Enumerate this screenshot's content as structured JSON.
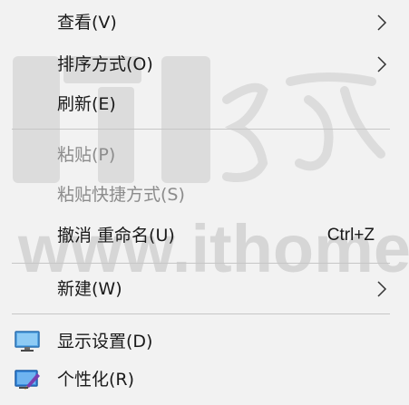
{
  "menu": {
    "items": [
      {
        "label": "查看(V)",
        "disabled": false,
        "submenu": true
      },
      {
        "label": "排序方式(O)",
        "disabled": false,
        "submenu": true
      },
      {
        "label": "刷新(E)",
        "disabled": false
      },
      {
        "label": "粘贴(P)",
        "disabled": true
      },
      {
        "label": "粘贴快捷方式(S)",
        "disabled": true
      },
      {
        "label": "撤消 重命名(U)",
        "shortcut": "Ctrl+Z",
        "disabled": false
      },
      {
        "label": "新建(W)",
        "disabled": false,
        "submenu": true
      },
      {
        "label": "显示设置(D)",
        "icon": "display-icon",
        "disabled": false
      },
      {
        "label": "个性化(R)",
        "icon": "personalize-icon",
        "disabled": false
      }
    ]
  },
  "watermark": {
    "text": "www.ithome.com"
  },
  "colors": {
    "text": "#1a1a1a",
    "disabled": "#8c8c8c",
    "background": "#f2f2f2",
    "separator": "#c6c6c6",
    "watermark": "#d4d4d4"
  }
}
